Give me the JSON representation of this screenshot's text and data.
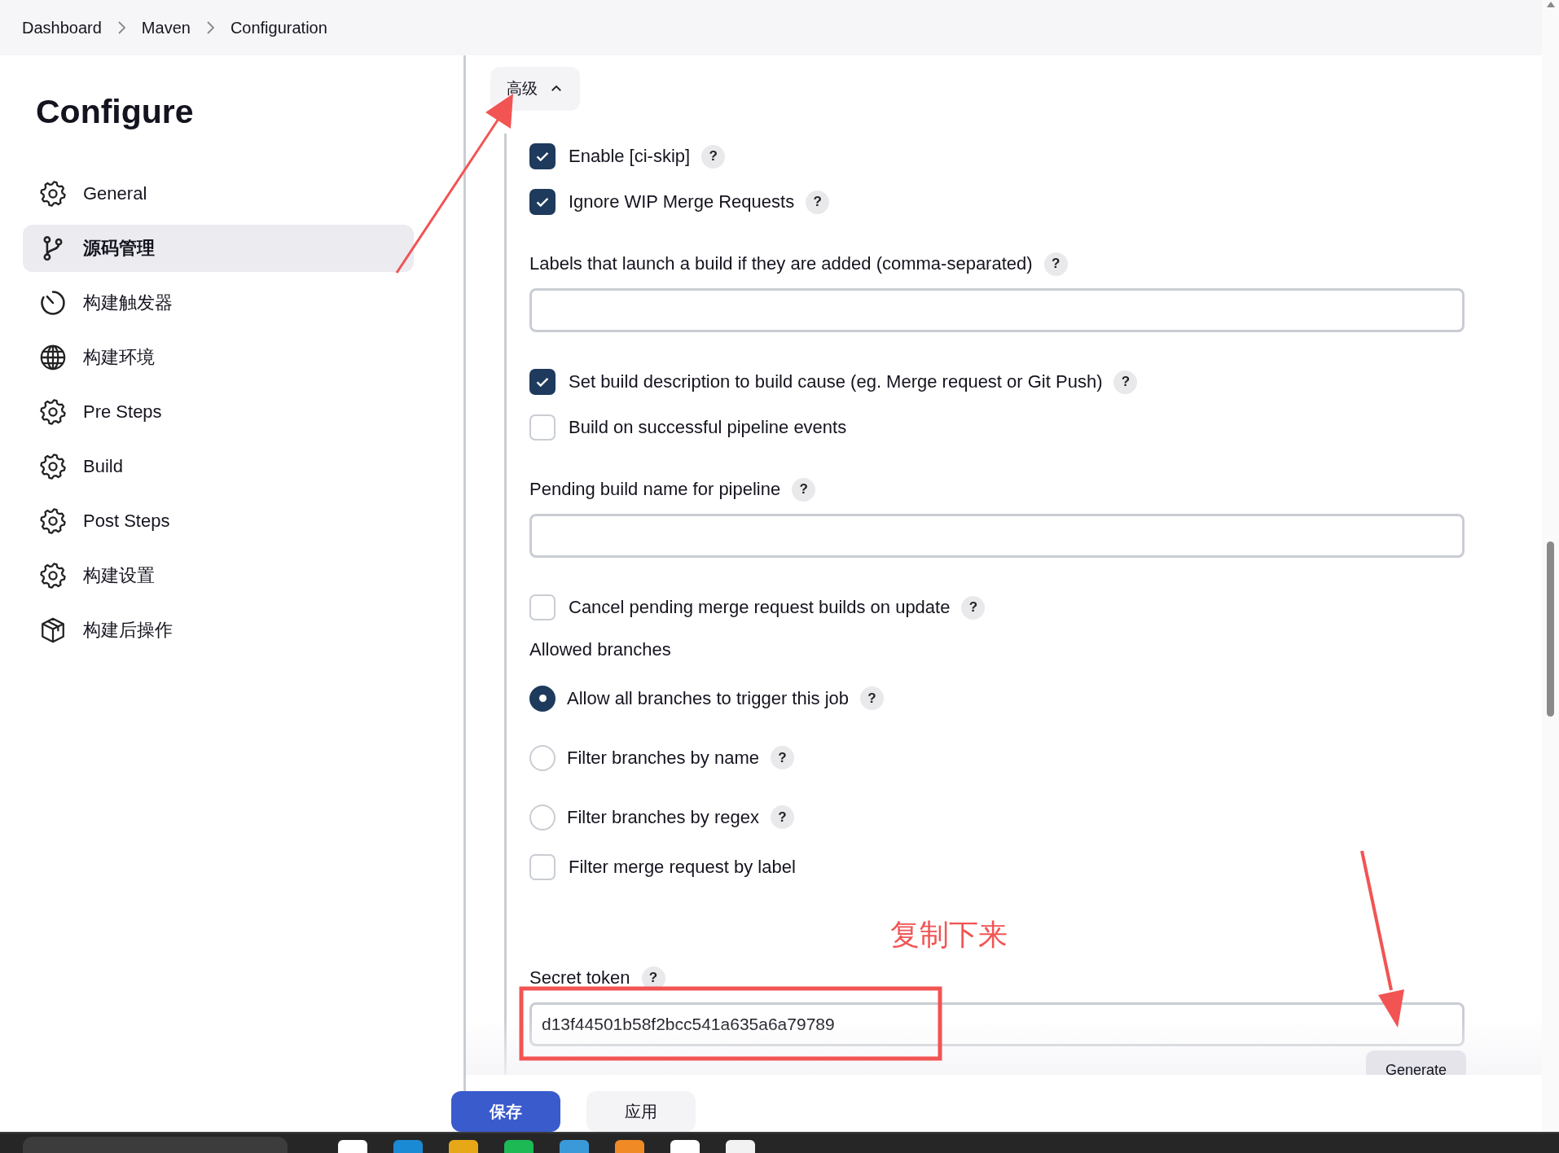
{
  "breadcrumbs": [
    "Dashboard",
    "Maven",
    "Configuration"
  ],
  "sidebar": {
    "title": "Configure",
    "items": [
      {
        "label": "General",
        "selected": false
      },
      {
        "label": "源码管理",
        "selected": true
      },
      {
        "label": "构建触发器",
        "selected": false
      },
      {
        "label": "构建环境",
        "selected": false
      },
      {
        "label": "Pre Steps",
        "selected": false
      },
      {
        "label": "Build",
        "selected": false
      },
      {
        "label": "Post Steps",
        "selected": false
      },
      {
        "label": "构建设置",
        "selected": false
      },
      {
        "label": "构建后操作",
        "selected": false
      }
    ]
  },
  "advanced_toggle": {
    "label": "高级",
    "expanded": true
  },
  "fields": [
    {
      "kind": "checkbox",
      "label": "Enable [ci-skip]",
      "checked": true,
      "help": "?"
    },
    {
      "kind": "checkbox",
      "label": "Ignore WIP Merge Requests",
      "checked": true,
      "help": "?"
    },
    {
      "kind": "text",
      "label": "Labels that launch a build if they are added (comma-separated)",
      "help": "?"
    },
    {
      "kind": "checkbox",
      "label": "Set build description to build cause (eg. Merge request or Git Push)",
      "checked": true,
      "help": "?"
    },
    {
      "kind": "checkbox",
      "label": "Build on successful pipeline events",
      "checked": false
    },
    {
      "kind": "text",
      "label": "Pending build name for pipeline",
      "help": "?"
    },
    {
      "kind": "checkbox",
      "label": "Cancel pending merge request builds on update",
      "checked": false,
      "help": "?"
    },
    {
      "kind": "heading",
      "label": "Allowed branches"
    },
    {
      "kind": "radio",
      "label": "Allow all branches to trigger this job",
      "selected": true,
      "help": "?"
    },
    {
      "kind": "radio",
      "label": "Filter branches by name",
      "selected": false,
      "help": "?"
    },
    {
      "kind": "radio",
      "label": "Filter branches by regex",
      "selected": false,
      "help": "?"
    },
    {
      "kind": "checkbox",
      "label": "Filter merge request by label",
      "checked": false
    },
    {
      "kind": "token",
      "label": "Secret token",
      "help": "?",
      "value": "d13f44501b58f2bcc541a635a6a79789",
      "button": "Generate"
    }
  ],
  "annotation": {
    "note": "复制下来"
  },
  "footer_buttons": [
    {
      "label": "保存",
      "kind": "primary"
    },
    {
      "label": "应用",
      "kind": "secondary"
    }
  ]
}
